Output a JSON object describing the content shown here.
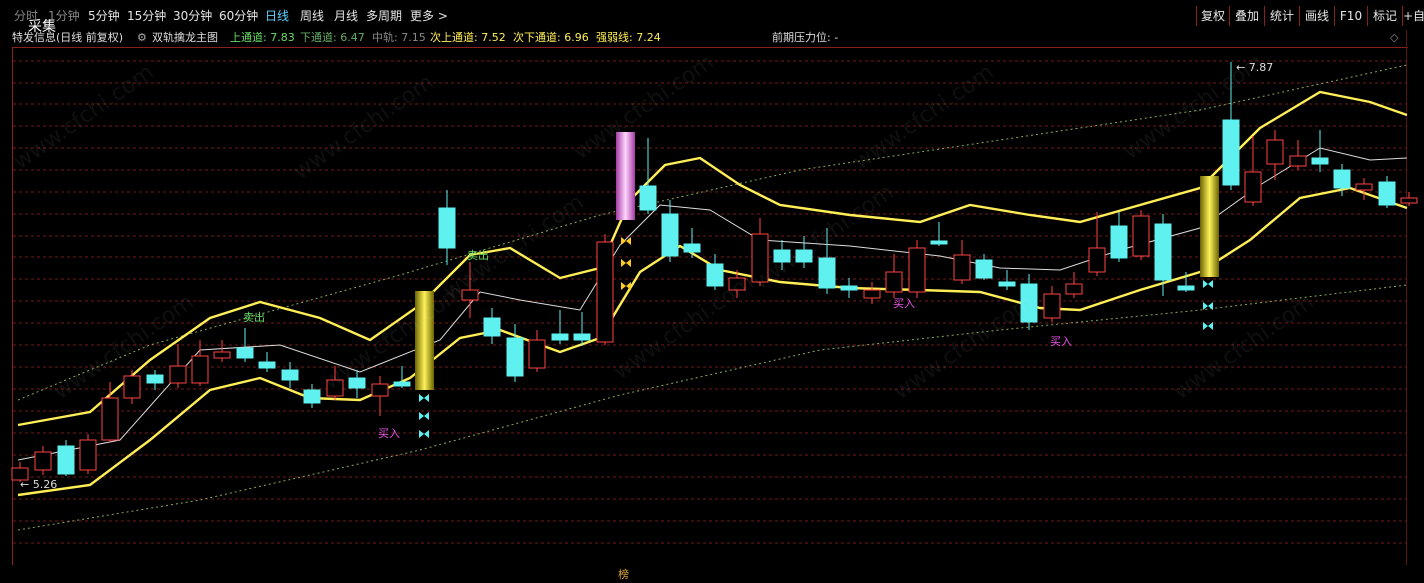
{
  "toolbar": {
    "collect_label": "采集",
    "timeframes": [
      "分时",
      "1分钟",
      "5分钟",
      "15分钟",
      "30分钟",
      "60分钟",
      "日线",
      "周线",
      "月线",
      "多周期",
      "更多 >"
    ],
    "active_timeframe": "日线",
    "right_buttons": [
      "复权",
      "叠加",
      "统计",
      "画线",
      "F10",
      "标记",
      "+自"
    ]
  },
  "info": {
    "stock": "特发信息(日线 前复权)",
    "indicator": "双轨擒龙主图",
    "upper_channel": "上通道: 7.83",
    "lower_channel": "下通道: 6.47",
    "mid_track": "中轨: 7.15",
    "sub_upper": "次上通道: 7.52",
    "sub_lower": "次下通道: 6.96",
    "strength": "强弱线: 7.24",
    "resistance": "前期压力位: -"
  },
  "chart": {
    "high_label": "7.87",
    "low_label": "5.26",
    "sell_label": "卖出",
    "buy_label": "买入",
    "bottom_tag": "榜",
    "watermark": "www.cfchi.com",
    "colors": {
      "up": "#ff4444",
      "down": "#5ff0f0",
      "band": "#ffee55",
      "mid": "#dddddd",
      "sell": "#66dd66",
      "buy": "#ee55ee",
      "dash_upper": "#88aa55",
      "dash_lower": "#88aa55"
    }
  }
}
